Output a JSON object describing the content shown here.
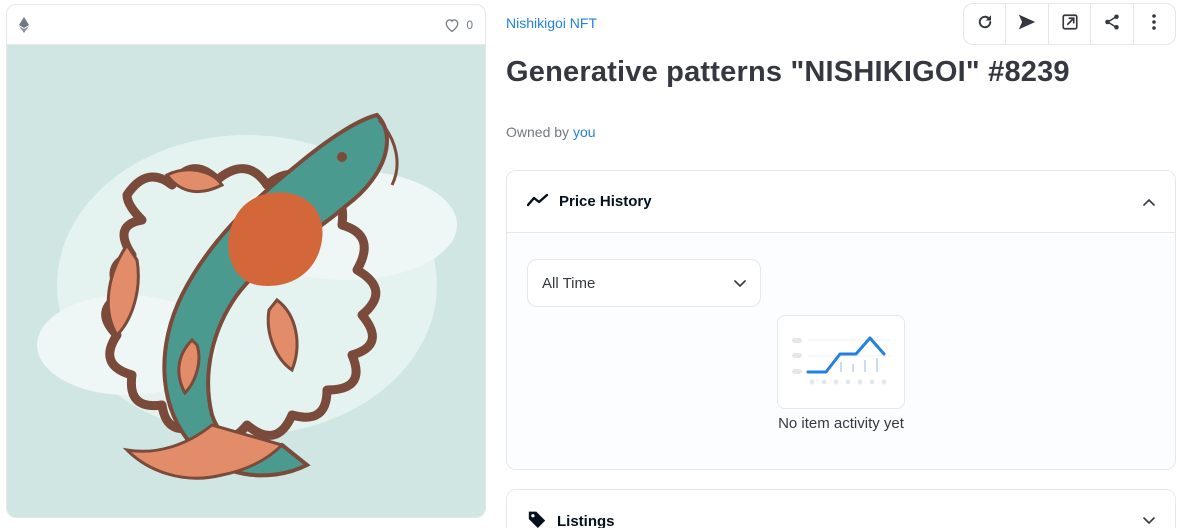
{
  "card": {
    "favorites_count": "0",
    "image_alt": "Koi fish artwork"
  },
  "header": {
    "collection": "Nishikigoi NFT",
    "title": "Generative patterns \"NISHIKIGOI\" #8239",
    "owned_prefix": "Owned by ",
    "owner": "you"
  },
  "toolbar": {
    "icons": [
      "refresh-icon",
      "send-icon",
      "external-link-icon",
      "share-icon",
      "more-vertical-icon"
    ]
  },
  "price_history": {
    "title": "Price History",
    "range": "All Time",
    "empty_message": "No item activity yet"
  },
  "listings": {
    "title": "Listings"
  },
  "colors": {
    "accent": "#2081e2",
    "chart_blue": "#2081e2",
    "image_bg": "#cfe6e3",
    "koi_orange": "#d4673a",
    "koi_teal": "#4b9a8f",
    "outline_brown": "#7a4a3a"
  }
}
